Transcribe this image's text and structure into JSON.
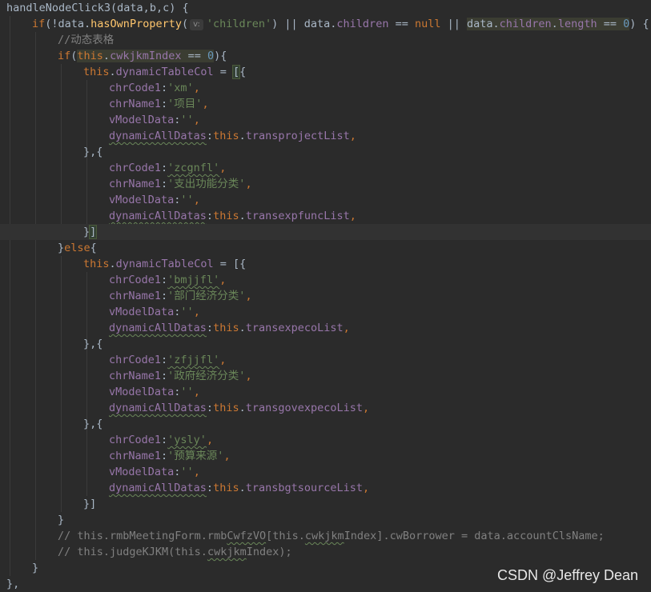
{
  "code": {
    "l1_fn": "handleNodeClick3",
    "l1_params": "(data,b,c) {",
    "l2_if": "if",
    "l2_a": "(!data.",
    "l2_method": "hasOwnProperty",
    "l2_paren": "(",
    "l2_hint": "v:",
    "l2_str": "'children'",
    "l2_b": ") || data.",
    "l2_children": "children",
    "l2_c": " == ",
    "l2_null": "null",
    "l2_d": " || ",
    "l2_data": "data.",
    "l2_children2": "children",
    "l2_dot": ".",
    "l2_length": "length",
    "l2_eq": " == ",
    "l2_zero": "0",
    "l2_end": ") {",
    "l3_comment": "//动态表格",
    "l4_if": "if",
    "l4_open": "(",
    "l4_this": "this",
    "l4_dot": ".",
    "l4_prop": "cwkjkmIndex",
    "l4_eq": " == ",
    "l4_zero": "0",
    "l4_end": "){",
    "l5_this": "this",
    "l5_dot": ".",
    "l5_prop": "dynamicTableCol",
    "l5_eq": " = ",
    "l5_bracket": "[",
    "l5_brace": "{",
    "k_code": "chrCode1",
    "k_name": "chrName1",
    "k_vmodel": "vModelData",
    "k_all": "dynamicAllDatas",
    "colon": ":",
    "comma": ",",
    "empty_str": "''",
    "this": "this",
    "dot": ".",
    "sep": "},{",
    "close_inner": "}",
    "close_bracket": "]",
    "else_close": "}",
    "else_kw": "else",
    "else_open": "{",
    "block_close": "}",
    "g1_code": "'xm'",
    "g1_name": "'项目'",
    "g1_list": "transprojectList",
    "g2_code": "'zcgnfl'",
    "g2_name": "'支出功能分类'",
    "g2_list": "transexpfuncList",
    "e_eq": " = [{",
    "g3_code": "'bmjjfl'",
    "g3_name": "'部门经济分类'",
    "g3_list": "transexpecoList",
    "g4_code": "'zfjjfl'",
    "g4_name": "'政府经济分类'",
    "g4_list": "transgovexpecoList",
    "g5_code": "'ysly'",
    "g5_name": "'预算来源'",
    "g5_list": "transbgtsourceList",
    "final_close": "}]",
    "cmt1_a": "// this.rmbMeetingForm.rmb",
    "cmt1_b": "CwfzVO",
    "cmt1_c": "[this.",
    "cmt1_d": "cwkjkm",
    "cmt1_e": "Index].cwBorrower = data.accountClsName;",
    "cmt2_a": "// this.judgeKJKM(this.",
    "cmt2_b": "cwkjkm",
    "cmt2_c": "Index);",
    "fn_close": "}",
    "last": "},"
  },
  "watermark": "CSDN @Jeffrey Dean",
  "colors": {
    "background": "#2b2b2b",
    "keyword": "#cc7832",
    "string": "#6a8759",
    "property": "#9876aa",
    "function": "#ffc66d",
    "number": "#6897bb",
    "comment": "#808080"
  }
}
